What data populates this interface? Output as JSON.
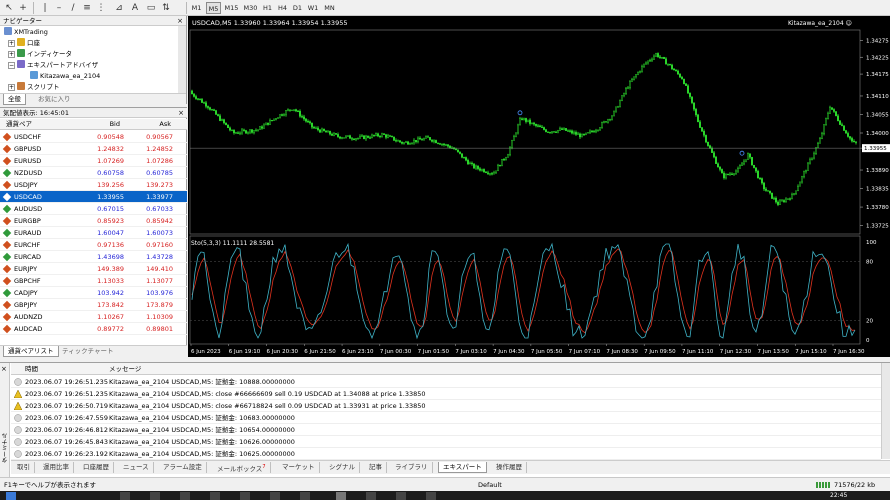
{
  "toolbar": {
    "timeframes": [
      "M1",
      "M5",
      "M15",
      "M30",
      "H1",
      "H4",
      "D1",
      "W1",
      "MN"
    ],
    "active_timeframe": "M5"
  },
  "navigator": {
    "title": "ナビゲーター",
    "items": [
      {
        "label": "XMTrading"
      },
      {
        "label": "口座"
      },
      {
        "label": "インディケータ"
      },
      {
        "label": "エキスパートアドバイザ"
      },
      {
        "label": "Kitazawa_ea_2104"
      },
      {
        "label": "スクリプト"
      }
    ],
    "tabs": [
      "全般",
      "お気に入り"
    ]
  },
  "market_watch": {
    "title": "気配値表示: 16:45:01",
    "columns": {
      "symbol": "通貨ペア",
      "bid": "Bid",
      "ask": "Ask"
    },
    "rows": [
      {
        "symbol": "USDCHF",
        "bid": "0.90548",
        "ask": "0.90567",
        "dir": "dn"
      },
      {
        "symbol": "GBPUSD",
        "bid": "1.24832",
        "ask": "1.24852",
        "dir": "dn"
      },
      {
        "symbol": "EURUSD",
        "bid": "1.07269",
        "ask": "1.07286",
        "dir": "dn"
      },
      {
        "symbol": "NZDUSD",
        "bid": "0.60758",
        "ask": "0.60785",
        "dir": "up"
      },
      {
        "symbol": "USDJPY",
        "bid": "139.256",
        "ask": "139.273",
        "dir": "dn"
      },
      {
        "symbol": "USDCAD",
        "bid": "1.33955",
        "ask": "1.33977",
        "dir": "sel"
      },
      {
        "symbol": "AUDUSD",
        "bid": "0.67015",
        "ask": "0.67033",
        "dir": "up"
      },
      {
        "symbol": "EURGBP",
        "bid": "0.85923",
        "ask": "0.85942",
        "dir": "dn"
      },
      {
        "symbol": "EURAUD",
        "bid": "1.60047",
        "ask": "1.60073",
        "dir": "up"
      },
      {
        "symbol": "EURCHF",
        "bid": "0.97136",
        "ask": "0.97160",
        "dir": "dn"
      },
      {
        "symbol": "EURCAD",
        "bid": "1.43698",
        "ask": "1.43728",
        "dir": "up"
      },
      {
        "symbol": "EURJPY",
        "bid": "149.389",
        "ask": "149.410",
        "dir": "dn"
      },
      {
        "symbol": "GBPCHF",
        "bid": "1.13033",
        "ask": "1.13077",
        "dir": "dn"
      },
      {
        "symbol": "CADJPY",
        "bid": "103.942",
        "ask": "103.976",
        "dir": "up"
      },
      {
        "symbol": "GBPJPY",
        "bid": "173.842",
        "ask": "173.879",
        "dir": "dn"
      },
      {
        "symbol": "AUDNZD",
        "bid": "1.10267",
        "ask": "1.10309",
        "dir": "dn"
      },
      {
        "symbol": "AUDCAD",
        "bid": "0.89772",
        "ask": "0.89801",
        "dir": "dn"
      }
    ],
    "tabs": [
      "通貨ペアリスト",
      "ティックチャート"
    ]
  },
  "chart": {
    "header": "USDCAD,M5  1.33960 1.33964 1.33954 1.33955",
    "ea_label": "Kitazawa_ea_2104 ☺",
    "price_labels": [
      "1.34275",
      "1.34225",
      "1.34175",
      "1.34110",
      "1.34055",
      "1.34000",
      "1.33955",
      "1.33890",
      "1.33835",
      "1.33780",
      "1.33725"
    ],
    "current_price": "1.33955",
    "stoch_header": "Sto(5,3,3) 11.1111 28.5581",
    "stoch_levels": [
      "100",
      "80",
      "20",
      "0"
    ],
    "time_labels": [
      "6 Jun 2023",
      "6 Jun 19:10",
      "6 Jun 20:30",
      "6 Jun 21:50",
      "6 Jun 23:10",
      "7 Jun 00:30",
      "7 Jun 01:50",
      "7 Jun 03:10",
      "7 Jun 04:30",
      "7 Jun 05:50",
      "7 Jun 07:10",
      "7 Jun 08:30",
      "7 Jun 09:50",
      "7 Jun 11:10",
      "7 Jun 12:30",
      "7 Jun 13:50",
      "7 Jun 15:10",
      "7 Jun 16:30"
    ],
    "colors": {
      "background": "#000000",
      "bull": "#33ff33",
      "grid": "#555555",
      "stoch_main": "#3fb4c8",
      "stoch_signal": "#e0321e"
    }
  },
  "terminal": {
    "side_label": "ターミナル",
    "columns": {
      "time": "時間",
      "message": "メッセージ"
    },
    "rows": [
      {
        "icon": "info",
        "time": "2023.06.07 19:26:51.235",
        "message": "Kitazawa_ea_2104 USDCAD,M5: 証拠金: 10888.00000000"
      },
      {
        "icon": "warn",
        "time": "2023.06.07 19:26:51.235",
        "message": "Kitazawa_ea_2104 USDCAD,M5: close #66666609 sell 0.19 USDCAD at 1.34088 at price 1.33850"
      },
      {
        "icon": "warn",
        "time": "2023.06.07 19:26:50.719",
        "message": "Kitazawa_ea_2104 USDCAD,M5: close #66718824 sell 0.09 USDCAD at 1.33931 at price 1.33850"
      },
      {
        "icon": "info",
        "time": "2023.06.07 19:26:47.559",
        "message": "Kitazawa_ea_2104 USDCAD,M5: 証拠金: 10683.00000000"
      },
      {
        "icon": "info",
        "time": "2023.06.07 19:26:46.812",
        "message": "Kitazawa_ea_2104 USDCAD,M5: 証拠金: 10654.00000000"
      },
      {
        "icon": "info",
        "time": "2023.06.07 19:26:45.843",
        "message": "Kitazawa_ea_2104 USDCAD,M5: 証拠金: 10626.00000000"
      },
      {
        "icon": "info",
        "time": "2023.06.07 19:26:23.192",
        "message": "Kitazawa_ea_2104 USDCAD,M5: 証拠金: 10625.00000000"
      }
    ],
    "tabs": [
      {
        "label": "取引",
        "badge": ""
      },
      {
        "label": "運用比率",
        "badge": ""
      },
      {
        "label": "口座履歴",
        "badge": ""
      },
      {
        "label": "ニュース",
        "badge": ""
      },
      {
        "label": "アラーム設定",
        "badge": ""
      },
      {
        "label": "メールボックス",
        "badge": "7"
      },
      {
        "label": "マーケット",
        "badge": ""
      },
      {
        "label": "シグナル",
        "badge": ""
      },
      {
        "label": "記事",
        "badge": ""
      },
      {
        "label": "ライブラリ",
        "badge": ""
      },
      {
        "label": "エキスパート",
        "badge": ""
      },
      {
        "label": "操作履歴",
        "badge": ""
      }
    ],
    "active_tab": "エキスパート"
  },
  "status_bar": {
    "help": "F1キーでヘルプが表示されます",
    "profile": "Default",
    "traffic": "71576/22 kb"
  },
  "taskbar": {
    "clock": "22:45"
  }
}
